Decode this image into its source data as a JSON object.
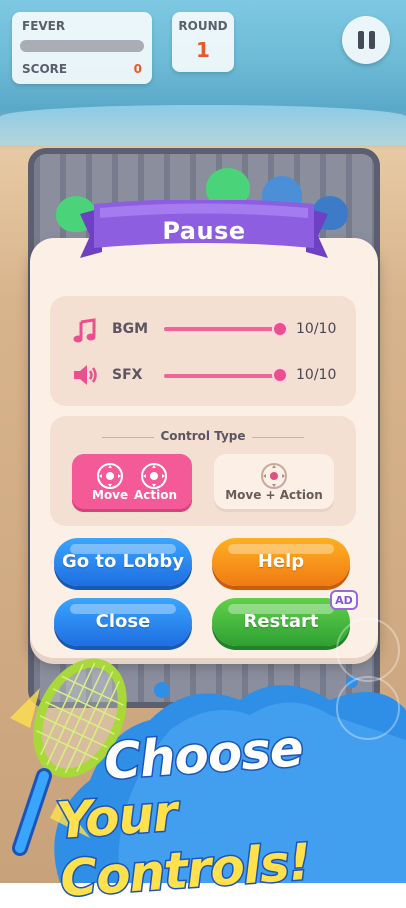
{
  "hud": {
    "fever_label": "FEVER",
    "score_label": "SCORE",
    "score_value": "0",
    "round_label": "ROUND",
    "round_value": "1"
  },
  "pause_dialog": {
    "title": "Pause",
    "sound": [
      {
        "icon": "music-note-icon",
        "label": "BGM",
        "value": "10/10",
        "level": 1.0
      },
      {
        "icon": "speaker-icon",
        "label": "SFX",
        "value": "10/10",
        "level": 1.0
      }
    ],
    "control_type": {
      "title": "Control Type",
      "options": [
        {
          "move_label": "Move",
          "action_label": "Action",
          "selected": true
        },
        {
          "label": "Move + Action",
          "selected": false
        }
      ]
    },
    "buttons": {
      "lobby": "Go to Lobby",
      "help": "Help",
      "close": "Close",
      "restart": "Restart",
      "ad_badge": "AD"
    }
  },
  "promo": {
    "line1": "Choose",
    "line2": "Your Controls!"
  },
  "colors": {
    "accent_pink": "#f45a97",
    "ribbon_purple": "#8d5ee0",
    "button_blue": "#1e6ee0",
    "button_orange": "#f07b14",
    "button_green": "#2ea033"
  }
}
